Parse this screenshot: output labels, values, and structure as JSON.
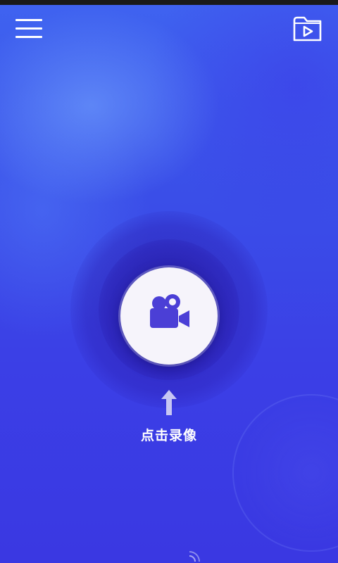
{
  "header": {
    "menu_icon": "menu-icon",
    "video_folder_icon": "video-folder-icon"
  },
  "main": {
    "record_button_icon": "video-camera-icon",
    "hint_icon": "arrow-up-icon",
    "record_label": "点击录像"
  },
  "colors": {
    "background_top": "#3f63f0",
    "background_bottom": "#3a38e2",
    "accent_purple": "#4b3fd6",
    "button_face": "#f6f4fb",
    "text": "#ffffff"
  }
}
